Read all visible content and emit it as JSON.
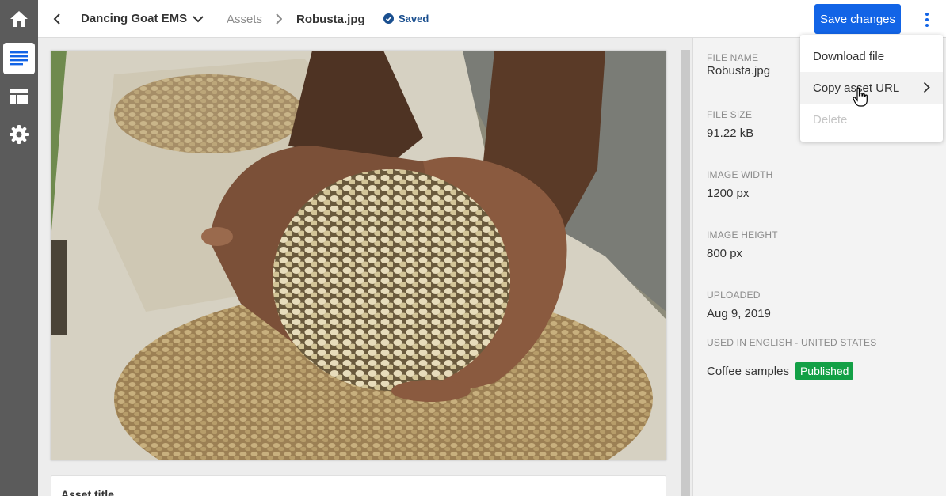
{
  "sidebar": {
    "items": [
      {
        "icon": "home-icon",
        "active": false
      },
      {
        "icon": "content-icon",
        "active": true
      },
      {
        "icon": "layout-icon",
        "active": false
      },
      {
        "icon": "settings-icon",
        "active": false
      }
    ]
  },
  "header": {
    "project_name": "Dancing Goat EMS",
    "breadcrumb_section": "Assets",
    "breadcrumb_current": "Robusta.jpg",
    "saved_status": "Saved",
    "save_button": "Save changes"
  },
  "menu": {
    "items": [
      {
        "label": "Download file",
        "state": "normal"
      },
      {
        "label": "Copy asset URL",
        "state": "hover",
        "has_submenu": true
      },
      {
        "label": "Delete",
        "state": "disabled"
      }
    ]
  },
  "asset": {
    "title_label": "Asset title"
  },
  "info": {
    "file_name_label": "FILE NAME",
    "file_name": "Robusta.jpg",
    "file_size_label": "FILE SIZE",
    "file_size": "91.22 kB",
    "width_label": "IMAGE WIDTH",
    "width": "1200 px",
    "height_label": "IMAGE HEIGHT",
    "height": "800 px",
    "uploaded_label": "UPLOADED",
    "uploaded": "Aug 9, 2019",
    "used_in_label": "USED IN ENGLISH - UNITED STATES",
    "usage_item": "Coffee samples",
    "usage_status": "Published"
  },
  "colors": {
    "accent": "#1264e6",
    "rail": "#5b5b5b",
    "published": "#13a046",
    "saved": "#1a4f8f"
  }
}
